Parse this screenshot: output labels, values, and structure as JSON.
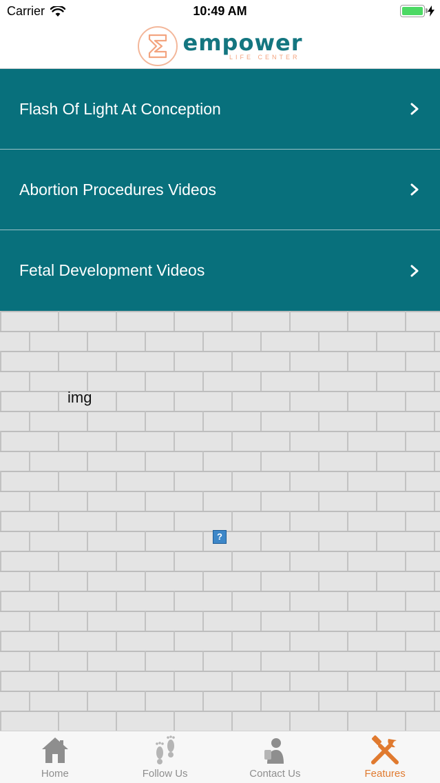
{
  "status_bar": {
    "carrier": "Carrier",
    "time": "10:49 AM"
  },
  "header": {
    "logo_word": "empower",
    "logo_sub": "LIFE CENTER",
    "colors": {
      "brand_teal": "#147680",
      "brand_peach": "#f3a47f"
    }
  },
  "menu": {
    "items": [
      {
        "label": "Flash Of Light At Conception",
        "icon": "chevron-right-icon"
      },
      {
        "label": "Abortion Procedures Videos",
        "icon": "chevron-right-icon"
      },
      {
        "label": "Fetal Development Videos",
        "icon": "chevron-right-icon"
      }
    ],
    "color": "#08707c"
  },
  "content": {
    "img_alt": "img",
    "broken_image_glyph": "?"
  },
  "tabbar": {
    "tabs": [
      {
        "label": "Home",
        "icon": "home-icon",
        "active": false
      },
      {
        "label": "Follow Us",
        "icon": "footprints-icon",
        "active": false
      },
      {
        "label": "Contact Us",
        "icon": "contact-person-icon",
        "active": false
      },
      {
        "label": "Features",
        "icon": "tools-icon",
        "active": true
      }
    ],
    "active_color": "#e07a2f",
    "inactive_color": "#8e8e8e"
  }
}
